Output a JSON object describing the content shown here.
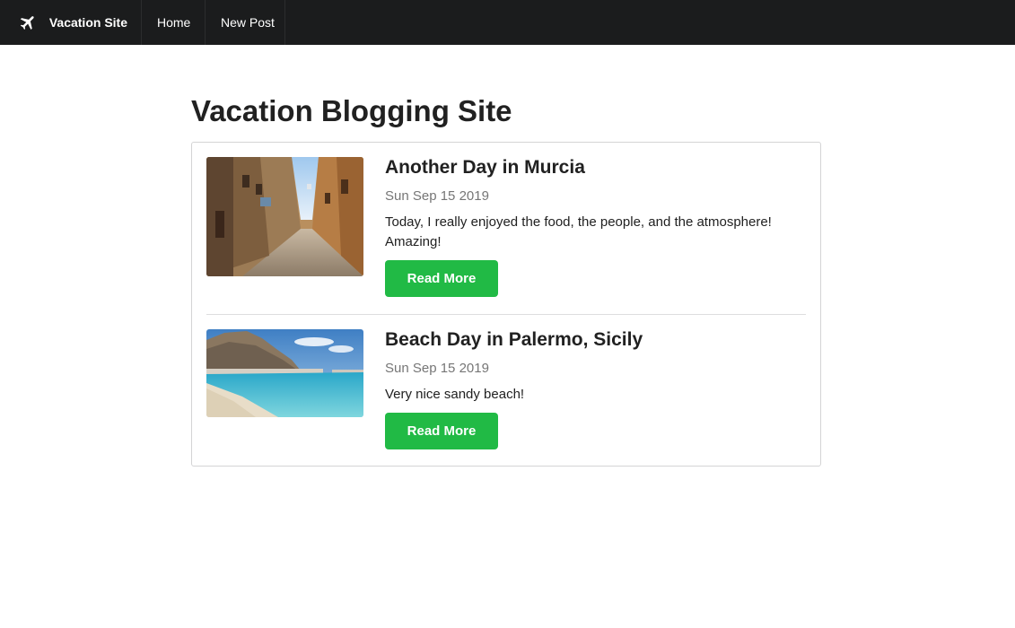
{
  "navbar": {
    "brand": "Vacation Site",
    "brand_icon": "airplane-icon",
    "items": [
      {
        "label": "Home"
      },
      {
        "label": "New Post"
      }
    ]
  },
  "page": {
    "title": "Vacation Blogging Site"
  },
  "posts": [
    {
      "title": "Another Day in Murcia",
      "date": "Sun Sep 15 2019",
      "excerpt": "Today, I really enjoyed the food, the people, and the atmosphere! Amazing!",
      "button": "Read More",
      "image": "narrow-old-town-street-photo"
    },
    {
      "title": "Beach Day in Palermo, Sicily",
      "date": "Sun Sep 15 2019",
      "excerpt": "Very nice sandy beach!",
      "button": "Read More",
      "image": "sandy-beach-with-mountain-photo"
    }
  ],
  "colors": {
    "navbar_bg": "#1b1c1d",
    "button_green": "#21ba45",
    "date_gray": "#767676"
  }
}
